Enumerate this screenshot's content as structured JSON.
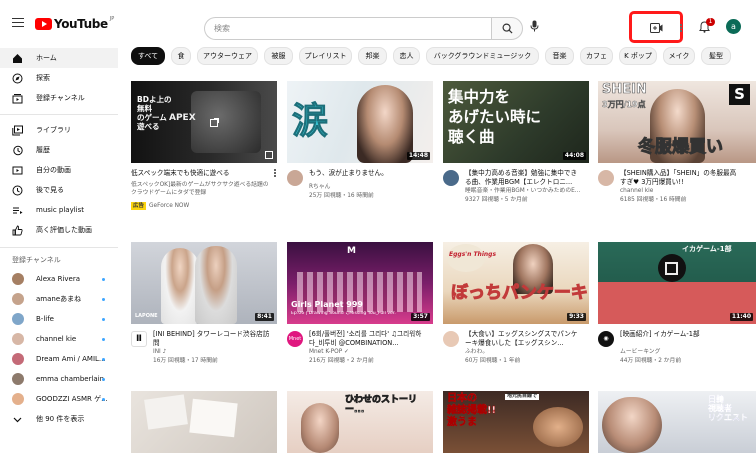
{
  "header": {
    "logo_text": "YouTube",
    "logo_region": "JP",
    "search_placeholder": "検索",
    "notification_count": "1",
    "avatar_initial": "a"
  },
  "sidebar": {
    "primary": [
      {
        "label": "ホーム",
        "icon": "home-icon",
        "active": true
      },
      {
        "label": "探索",
        "icon": "compass-icon"
      },
      {
        "label": "登録チャンネル",
        "icon": "subscriptions-icon"
      }
    ],
    "library": [
      {
        "label": "ライブラリ",
        "icon": "library-icon"
      },
      {
        "label": "履歴",
        "icon": "history-icon"
      },
      {
        "label": "自分の動画",
        "icon": "my-videos-icon"
      },
      {
        "label": "後で見る",
        "icon": "watch-later-icon"
      },
      {
        "label": "music playlist",
        "icon": "playlist-icon"
      },
      {
        "label": "高く評価した動画",
        "icon": "thumbs-up-icon"
      }
    ],
    "subscriptions_heading": "登録チャンネル",
    "subscriptions": [
      {
        "name": "Alexa Rivera",
        "color": "#a57f63"
      },
      {
        "name": "amaneあまね",
        "color": "#c5a38c"
      },
      {
        "name": "B-life",
        "color": "#7fa6c9"
      },
      {
        "name": "channel kie",
        "color": "#d7b7a6"
      },
      {
        "name": "Dream Ami / AMIL...",
        "color": "#c46a77"
      },
      {
        "name": "emma chamberlain",
        "color": "#8d7a6c"
      },
      {
        "name": "GOODZZI ASMR ゲ...",
        "color": "#e4b08c"
      }
    ],
    "show_more": "他 90 件を表示"
  },
  "chips": [
    "すべて",
    "食",
    "アウターウェア",
    "被服",
    "プレイリスト",
    "邦楽",
    "恋人",
    "バックグラウンドミュージック",
    "音楽",
    "カフェ",
    "K ポップ",
    "メイク",
    "髪型"
  ],
  "videos_row1": [
    {
      "title": "低スペック端末でも快適に遊べる",
      "line2": "低スペックOK]最新のゲームがサクサク遊べる話題のクラウドゲームにタダで登録",
      "channel": "GeForce NOW",
      "ad_label": "広告",
      "duration": "",
      "thumb_text": "BDよ上の\n無料\nのゲーム\n遊べる",
      "thumb_label": "APEX"
    },
    {
      "title": "もう、涙が止まりません。",
      "channel": "Rちゃん",
      "stats": "25万 回視聴・16 時間前",
      "duration": "14:48",
      "thumb_text": "涙"
    },
    {
      "title": "【集中力高める音楽】勉強に集中できる曲、作業用BGM【エレクトロニ...",
      "channel": "睡眠音楽・作業用BGM・いつかみためのE...",
      "stats": "9327 回視聴・5 か月前",
      "duration": "44:08",
      "thumb_text": "集中力を\nあげたい時に\n聴く曲"
    },
    {
      "title": "【SHEIN購入品】「SHEIN」の冬服最高すぎ♥ 3万円爆買い!!",
      "channel": "channel kie",
      "stats": "6185 回視聴・16 時間前",
      "duration": "",
      "thumb_text": "冬服爆買い",
      "thumb_brand": "SHEIN",
      "thumb_price": "3万円/19点"
    }
  ],
  "videos_row2": [
    {
      "title": "[INI BEHIND] タワーレコード渋谷店訪問",
      "channel": "INI ♪",
      "stats": "16万 回視聴・17 時間前",
      "duration": "8:41",
      "thumb_label": "LAPONE"
    },
    {
      "title": "[6회/풀버전] '소리를 그리다' ♫그리워하다_비투비 @COMBINATION...",
      "channel": "Mnet K-POP ✓",
      "stats": "216万 回視聴・2 か月前",
      "duration": "3:57",
      "thumb_text": "Girls Planet 999",
      "thumb_sub": "Ep.06 | Drawing Sound ♫Missing You_Full ver."
    },
    {
      "title": "【大食い】エッグスシングスでパンケーキ爆食いした【エッグスシン...",
      "channel": "ふわわ。",
      "stats": "60万 回視聴・1 年前",
      "duration": "9:33",
      "thumb_text": "ぼっちパンケーキ",
      "thumb_brand": "Eggs'n Things"
    },
    {
      "title": "[映画紹介] イカゲーム-1部",
      "channel": "ムービーキング",
      "stats": "44万 回視聴・2 か月前",
      "duration": "11:40",
      "thumb_text": "イカゲーム-1部"
    }
  ],
  "videos_row3": [
    {
      "thumb_text": ""
    },
    {
      "thumb_text": "ひわせのストーリー..."
    },
    {
      "thumb_text": "日本の\n雑誌掲載!!\n激うま",
      "thumb_tag": "地元民目線で"
    },
    {
      "thumb_text": "日韓\n視聴者\nリクエスト"
    }
  ],
  "colors": {
    "accent": "#ff0000",
    "link_blue": "#3ea6ff",
    "highlight": "#ff1a1a"
  }
}
